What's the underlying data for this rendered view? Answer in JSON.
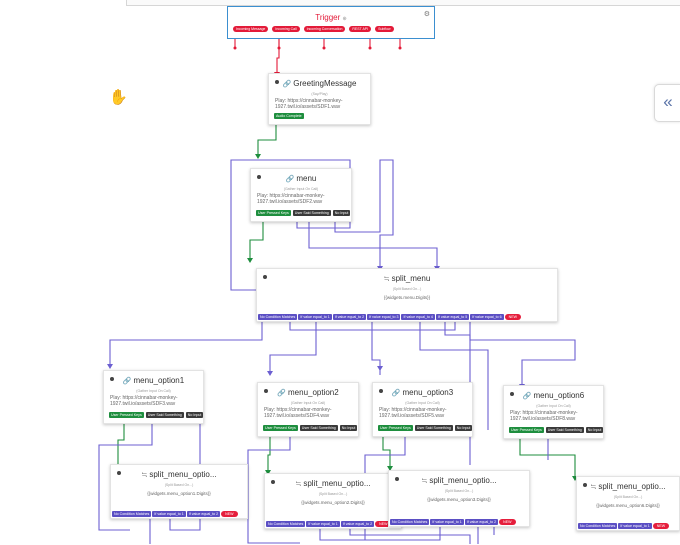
{
  "trigger": {
    "title": "Trigger",
    "info_icon": "info-icon",
    "settings_icon": "gear-icon",
    "tabs": [
      "Incoming Message",
      "Incoming Call",
      "Incoming Conversation",
      "REST API",
      "Subflow"
    ]
  },
  "sidebar": {
    "collapse_icon": "double-chevron-left-icon",
    "collapse_glyph": "«"
  },
  "cursor": {
    "icon": "hand-cursor-icon",
    "glyph": "✋"
  },
  "link_glyph": "🔗",
  "split_glyph": "≒",
  "nodes": {
    "greeting": {
      "title": "GreetingMessage",
      "subtitle": "(Say/Play)",
      "text": "Play: https://cinnabar-monkey-1927.twil.io/assets/SDF1.wav",
      "outputs": [
        "Audio Complete"
      ]
    },
    "menu": {
      "title": "menu",
      "subtitle": "(Gather Input On Call)",
      "text": "Play: https://cinnabar-monkey-1927.twil.io/assets/SDF2.wav",
      "outputs": [
        "User Pressed Keys",
        "User Said Something",
        "No Input"
      ]
    },
    "split_menu": {
      "title": "split_menu",
      "subtitle": "(Split Based On...)",
      "text": "{{widgets.menu.Digits}}",
      "outputs": [
        "No Condition Matches",
        "If value equal_to 1",
        "If value equal_to 2",
        "If value equal_to 3",
        "If value equal_to 4",
        "If value equal_to 5",
        "If value equal_to 6"
      ],
      "new_label": "NEW"
    },
    "menu_option1": {
      "title": "menu_option1",
      "subtitle": "(Gather Input On Call)",
      "text": "Play: https://cinnabar-monkey-1927.twil.io/assets/SDF3.wav",
      "outputs": [
        "User Pressed Keys",
        "User Said Something",
        "No Input"
      ]
    },
    "menu_option2": {
      "title": "menu_option2",
      "subtitle": "(Gather Input On Call)",
      "text": "Play: https://cinnabar-monkey-1927.twil.io/assets/SDF4.wav",
      "outputs": [
        "User Pressed Keys",
        "User Said Something",
        "No Input"
      ]
    },
    "menu_option3": {
      "title": "menu_option3",
      "subtitle": "(Gather Input On Call)",
      "text": "Play: https://cinnabar-monkey-1927.twil.io/assets/SDF5.wav",
      "outputs": [
        "User Pressed Keys",
        "User Said Something",
        "No Input"
      ]
    },
    "menu_option6": {
      "title": "menu_option6",
      "subtitle": "(Gather Input On Call)",
      "text": "Play: https://cinnabar-monkey-1927.twil.io/assets/SDF8.wav",
      "outputs": [
        "User Pressed Keys",
        "User Said Something",
        "No Input"
      ]
    },
    "split_menu_option1": {
      "title": "split_menu_optio...",
      "subtitle": "(Split Based On...)",
      "text": "{{widgets.menu_option1.Digits}}",
      "outputs": [
        "No Condition Matches",
        "If value equal_to 1",
        "If value equal_to 2"
      ],
      "new_label": "NEW"
    },
    "split_menu_option2": {
      "title": "split_menu_optio...",
      "subtitle": "(Split Based On...)",
      "text": "{{widgets.menu_option2.Digits}}",
      "outputs": [
        "No Condition Matches",
        "If value equal_to 1",
        "If value equal_to 2"
      ],
      "new_label": "NEW"
    },
    "split_menu_option3": {
      "title": "split_menu_optio...",
      "subtitle": "(Split Based On...)",
      "text": "{{widgets.menu_option3.Digits}}",
      "outputs": [
        "No Condition Matches",
        "If value equal_to 1",
        "If value equal_to 2"
      ],
      "new_label": "NEW"
    },
    "split_menu_option6": {
      "title": "split_menu_optio...",
      "subtitle": "(Split Based On...)",
      "text": "{{widgets.menu_option6.Digits}}",
      "outputs": [
        "No Condition Matches",
        "If value equal_to 1"
      ],
      "new_label": "NEW"
    }
  },
  "colors": {
    "trigger_red": "#e31a38",
    "success_green": "#1e8e3e",
    "split_purple": "#5b4fc4",
    "dark_output": "#3a3a3a",
    "wire_purple": "#6c5fd1",
    "selection_blue": "#3b8fd0"
  }
}
